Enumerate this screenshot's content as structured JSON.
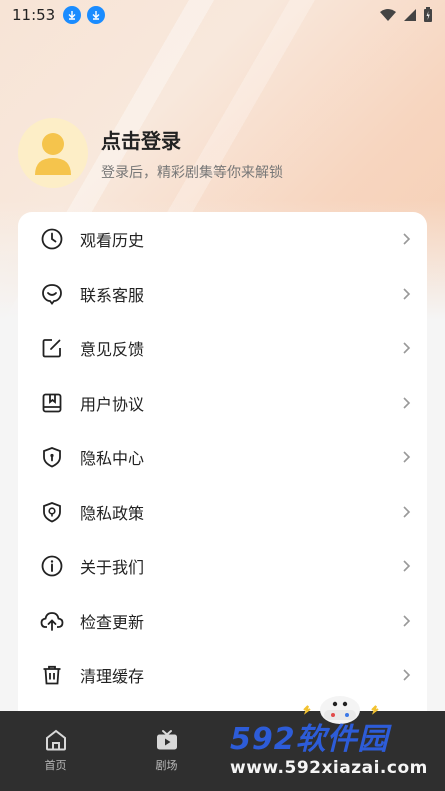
{
  "status_bar": {
    "time": "11:53"
  },
  "profile": {
    "title": "点击登录",
    "subtitle": "登录后，精彩剧集等你来解锁"
  },
  "menu": [
    {
      "icon": "clock-icon",
      "label": "观看历史"
    },
    {
      "icon": "headset-icon",
      "label": "联系客服"
    },
    {
      "icon": "edit-icon",
      "label": "意见反馈"
    },
    {
      "icon": "book-icon",
      "label": "用户协议"
    },
    {
      "icon": "shield-lock-icon",
      "label": "隐私中心"
    },
    {
      "icon": "shield-policy-icon",
      "label": "隐私政策"
    },
    {
      "icon": "info-icon",
      "label": "关于我们"
    },
    {
      "icon": "upload-cloud-icon",
      "label": "检查更新"
    },
    {
      "icon": "trash-icon",
      "label": "清理缓存"
    }
  ],
  "tabbar": {
    "tabs": [
      {
        "icon": "home-icon",
        "label": "首页"
      },
      {
        "icon": "tv-play-icon",
        "label": "剧场"
      }
    ]
  },
  "watermark": {
    "logo_number": "592",
    "logo_text": "软件园",
    "url": "www.592xiazai.com"
  },
  "colors": {
    "accent_blue": "#1a8cff",
    "avatar_yellow": "#f5c44c",
    "tabbar_bg": "#2f2f2f",
    "watermark_blue": "#2d5cd8"
  }
}
